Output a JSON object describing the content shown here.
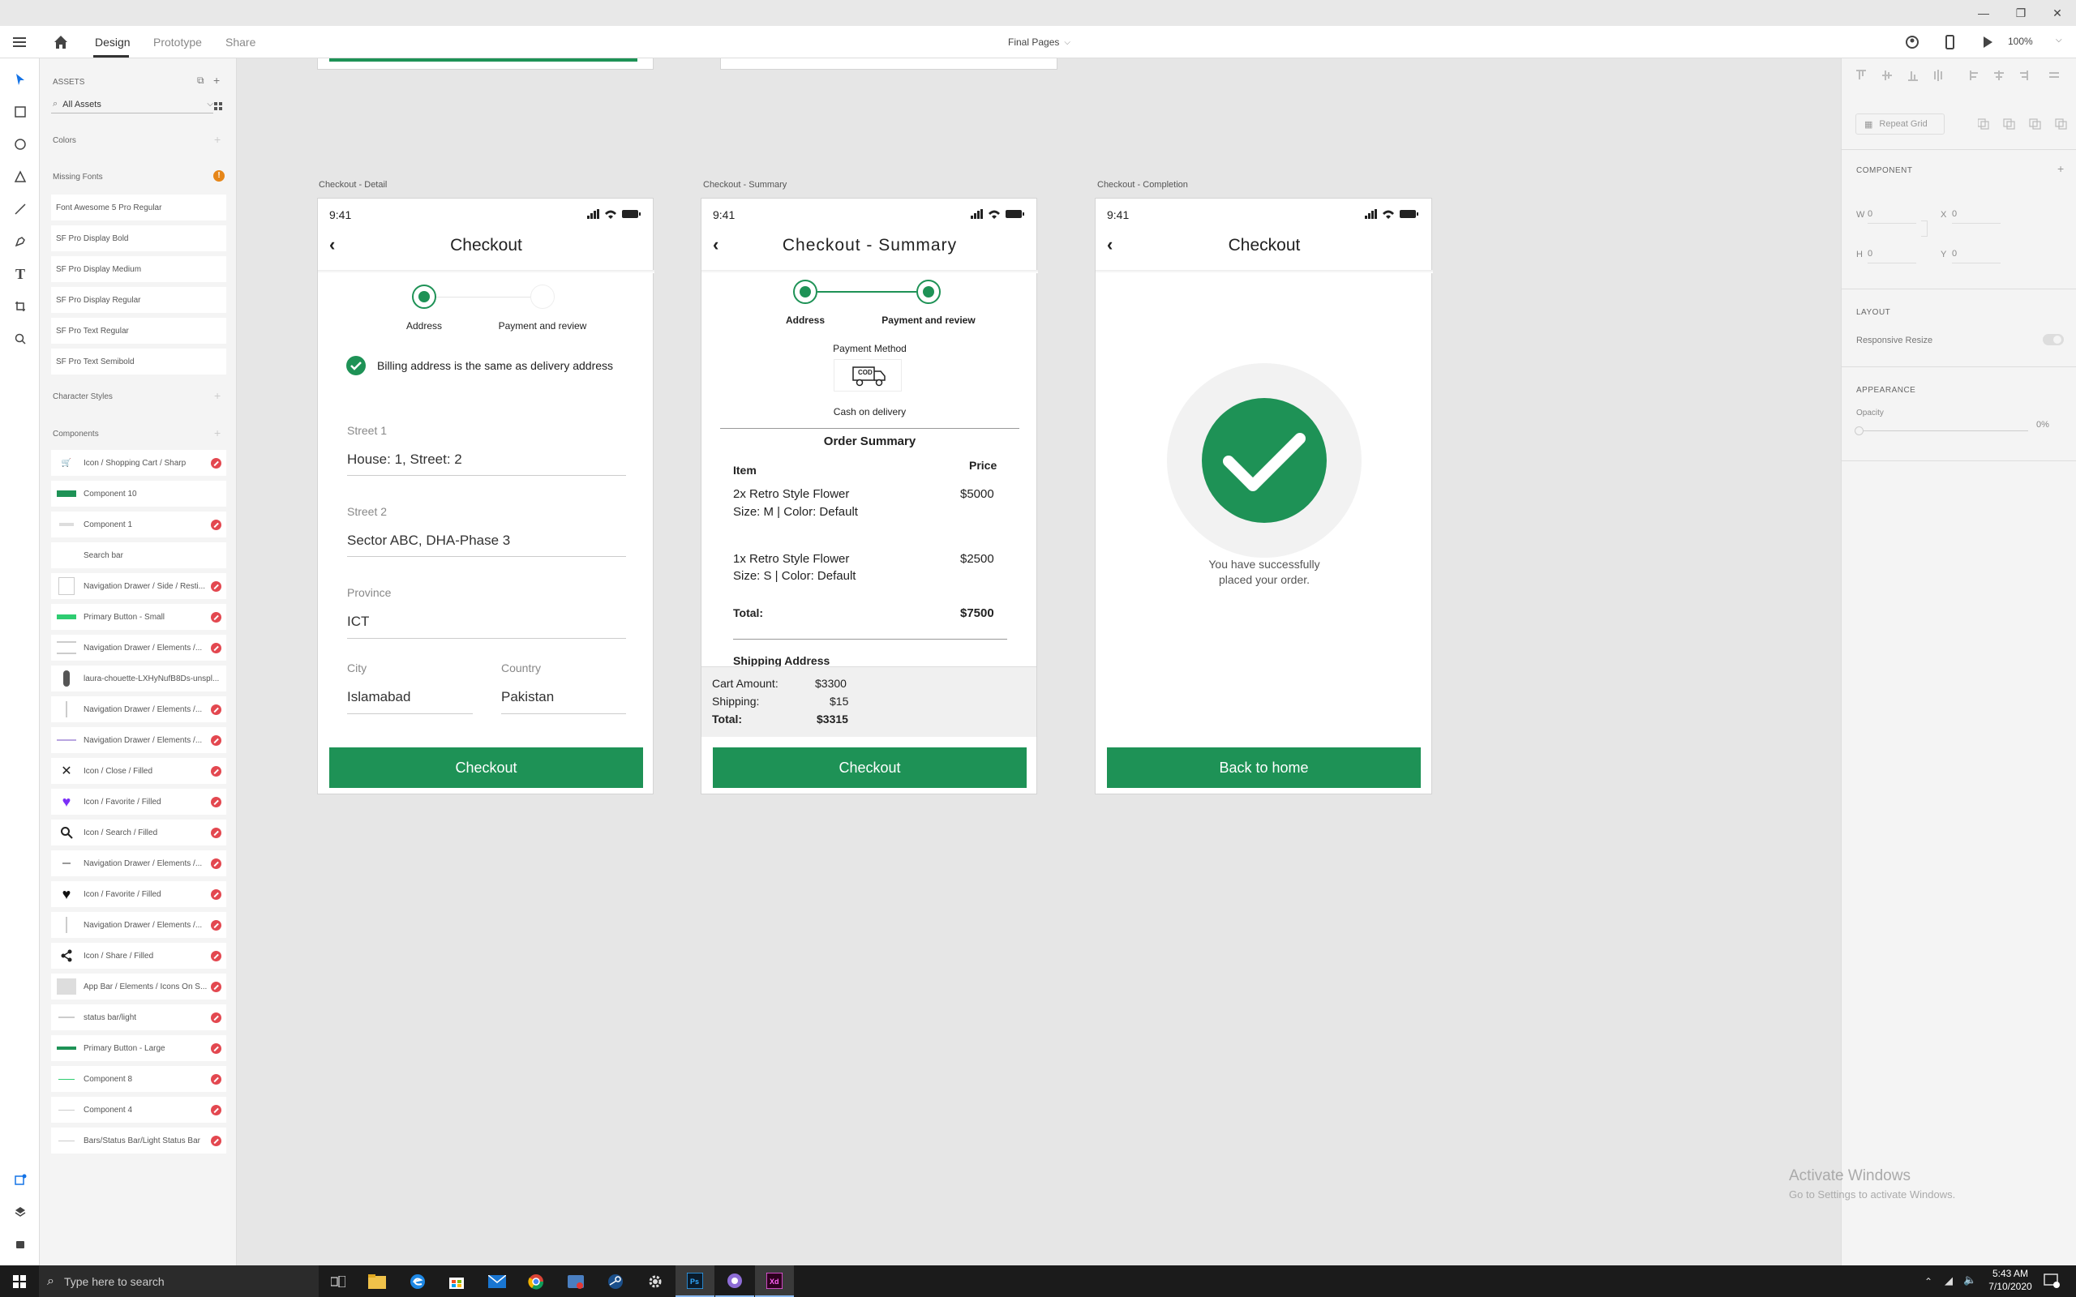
{
  "window": {
    "minimize": "—",
    "restore": "❐",
    "close": "✕"
  },
  "topbar": {
    "tabs": [
      "Design",
      "Prototype",
      "Share"
    ],
    "document": "Final Pages",
    "zoom": "100%"
  },
  "assets": {
    "title": "ASSETS",
    "search_placeholder": "All Assets",
    "colors": "Colors",
    "missing_fonts": "Missing Fonts",
    "fonts": [
      "Font Awesome 5 Pro Regular",
      "SF Pro Display Bold",
      "SF Pro Display Medium",
      "SF Pro Display Regular",
      "SF Pro Text Regular",
      "SF Pro Text Semibold"
    ],
    "character_styles": "Character Styles",
    "components": "Components",
    "component_list": [
      "Icon / Shopping Cart / Sharp",
      "Component 10",
      "Component 1",
      "Search bar",
      "Navigation Drawer / Side / Resti...",
      "Primary Button - Small",
      "Navigation Drawer / Elements /...",
      "laura-chouette-LXHyNufB8Ds-unspl...",
      "Navigation Drawer / Elements /...",
      "Navigation Drawer / Elements /...",
      "Icon / Close / Filled",
      "Icon / Favorite / Filled",
      "Icon / Search / Filled",
      "Navigation Drawer / Elements /...",
      "Icon / Favorite / Filled",
      "Navigation Drawer / Elements /...",
      "Icon / Share / Filled",
      "App Bar / Elements / Icons On S...",
      "status bar/light",
      "Primary Button - Large",
      "Component 8",
      "Component 4",
      "Bars/Status Bar/Light Status Bar"
    ]
  },
  "artboards": {
    "detail": {
      "label": "Checkout - Detail",
      "time": "9:41",
      "title": "Checkout",
      "step1": "Address",
      "step2": "Payment and review",
      "billing": "Billing address is the same as delivery address",
      "street1_label": "Street 1",
      "street1": "House: 1, Street: 2",
      "street2_label": "Street 2",
      "street2": "Sector ABC, DHA-Phase 3",
      "province_label": "Province",
      "province": "ICT",
      "city_label": "City",
      "city": "Islamabad",
      "country_label": "Country",
      "country": "Pakistan",
      "button": "Checkout"
    },
    "summary": {
      "label": "Checkout - Summary",
      "time": "9:41",
      "title": "Checkout - Summary",
      "step1": "Address",
      "step2": "Payment and review",
      "payment_method": "Payment Method",
      "cod": "COD",
      "payment_value": "Cash on delivery",
      "order_summary": "Order Summary",
      "col_item": "Item",
      "col_price": "Price",
      "items": [
        {
          "name": "2x Retro Style Flower",
          "details": "Size: M | Color: Default",
          "price": "$5000"
        },
        {
          "name": "1x Retro Style Flower",
          "details": "Size: S | Color: Default",
          "price": "$2500"
        }
      ],
      "total_label": "Total:",
      "total": "$7500",
      "shipping_address": "Shipping Address",
      "cart_amount_label": "Cart Amount:",
      "cart_amount": "$3300",
      "shipping_label": "Shipping:",
      "shipping": "$15",
      "grand_total_label": "Total:",
      "grand_total": "$3315",
      "button": "Checkout"
    },
    "completion": {
      "label": "Checkout - Completion",
      "time": "9:41",
      "title": "Checkout",
      "message_line1": "You have successfully",
      "message_line2": "placed your order.",
      "button": "Back to home"
    }
  },
  "rightpanel": {
    "repeat_grid": "Repeat Grid",
    "component": "COMPONENT",
    "w_label": "W",
    "w": "0",
    "x_label": "X",
    "x": "0",
    "h_label": "H",
    "h": "0",
    "y_label": "Y",
    "y": "0",
    "layout": "LAYOUT",
    "responsive": "Responsive Resize",
    "appearance": "APPEARANCE",
    "opacity_label": "Opacity",
    "opacity": "0%"
  },
  "watermark": {
    "line1": "Activate Windows",
    "line2": "Go to Settings to activate Windows."
  },
  "taskbar": {
    "search_placeholder": "Type here to search",
    "time": "5:43 AM",
    "date": "7/10/2020"
  },
  "colors": {
    "accent": "#1e9256",
    "badge": "#e34850"
  }
}
